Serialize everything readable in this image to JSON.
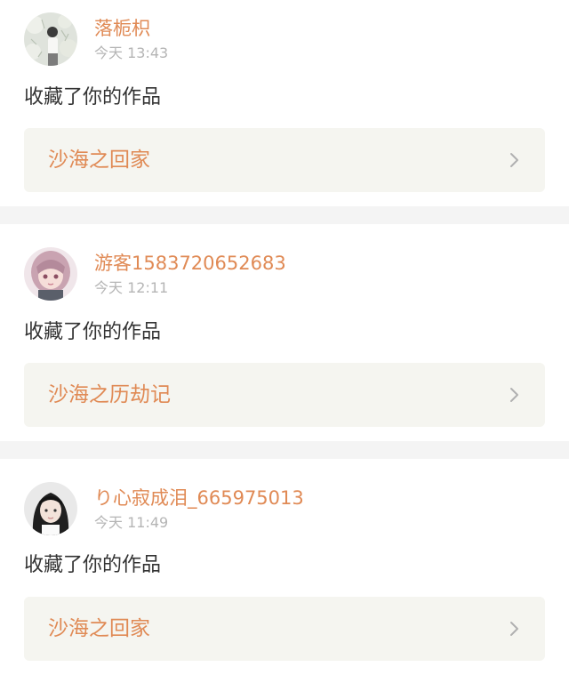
{
  "notifications": [
    {
      "username": "落栀枳",
      "time": "今天 13:43",
      "action": "收藏了你的作品",
      "work_title": "沙海之回家"
    },
    {
      "username": "游客1583720652683",
      "time": "今天 12:11",
      "action": "收藏了你的作品",
      "work_title": "沙海之历劫记"
    },
    {
      "username": "り心寂成泪_665975013",
      "time": "今天 11:49",
      "action": "收藏了你的作品",
      "work_title": "沙海之回家"
    }
  ],
  "colors": {
    "accent": "#e08a55",
    "time": "#b5b5b5",
    "text": "#333333",
    "link_bg": "#f5f5f0",
    "separator": "#f4f4f4"
  },
  "icons": {
    "avatar_1": "avatar-man-in-white-icon",
    "avatar_2": "avatar-anime-girl-icon",
    "avatar_3": "avatar-girl-photo-icon",
    "chevron": "chevron-right-icon"
  }
}
